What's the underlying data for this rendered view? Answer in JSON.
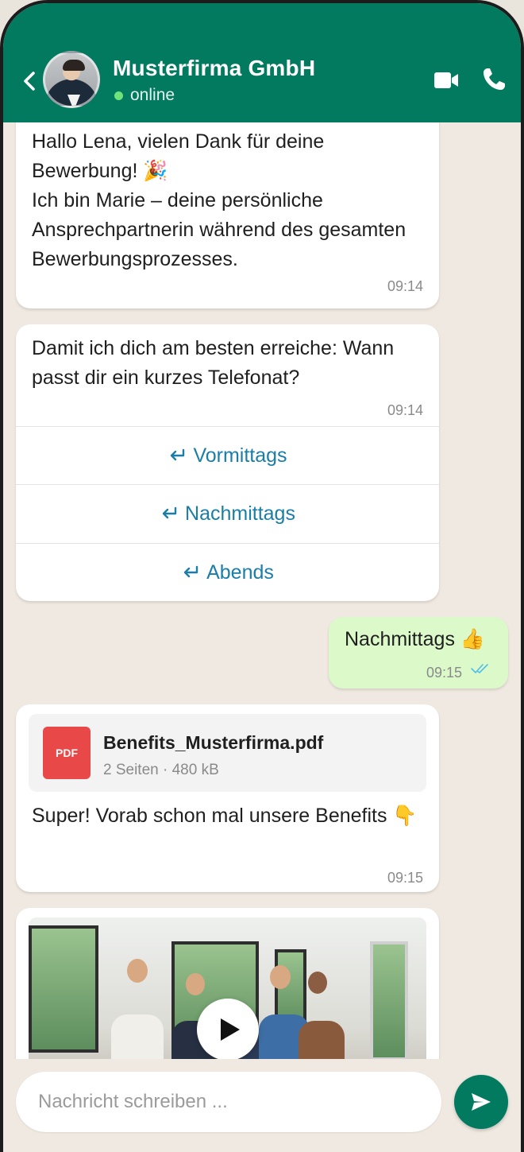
{
  "header": {
    "contact_name": "Musterfirma GmbH",
    "status": "online",
    "icons": [
      "back-chevron-icon",
      "video-call-icon",
      "phone-call-icon"
    ],
    "colors": {
      "header_bg": "#017a5f",
      "online_dot": "#6fe27a"
    }
  },
  "messages": [
    {
      "type": "incoming",
      "text": "Hallo Lena, vielen Dank für deine Bewerbung! 🎉\nIch bin Marie – deine persönliche Ansprechpartnerin während des gesamten Bewerbungsprozesses.",
      "time": "09:14"
    },
    {
      "type": "incoming",
      "text": "Damit ich dich am besten erreiche: Wann passt dir ein kurzes Telefonat?",
      "time": "09:14",
      "quick_replies": [
        "Vormittags",
        "Nachmittags",
        "Abends"
      ]
    },
    {
      "type": "outgoing",
      "text": "Nachmittags 👍",
      "time": "09:15",
      "read": true
    },
    {
      "type": "incoming",
      "file": {
        "icon_label": "PDF",
        "name": "Benefits_Musterfirma.pdf",
        "meta": "2 Seiten · 480 kB"
      },
      "text": "Super! Vorab schon mal unsere Benefits 👇",
      "time": "09:15"
    },
    {
      "type": "incoming",
      "media": "video-thumbnail"
    }
  ],
  "composer": {
    "placeholder": "Nachricht schreiben ...",
    "send_icon": "send-icon",
    "colors": {
      "send_bg": "#017a5f",
      "outgoing_bubble": "#dcf9c9",
      "quick_reply_text": "#1a7ea8"
    }
  }
}
